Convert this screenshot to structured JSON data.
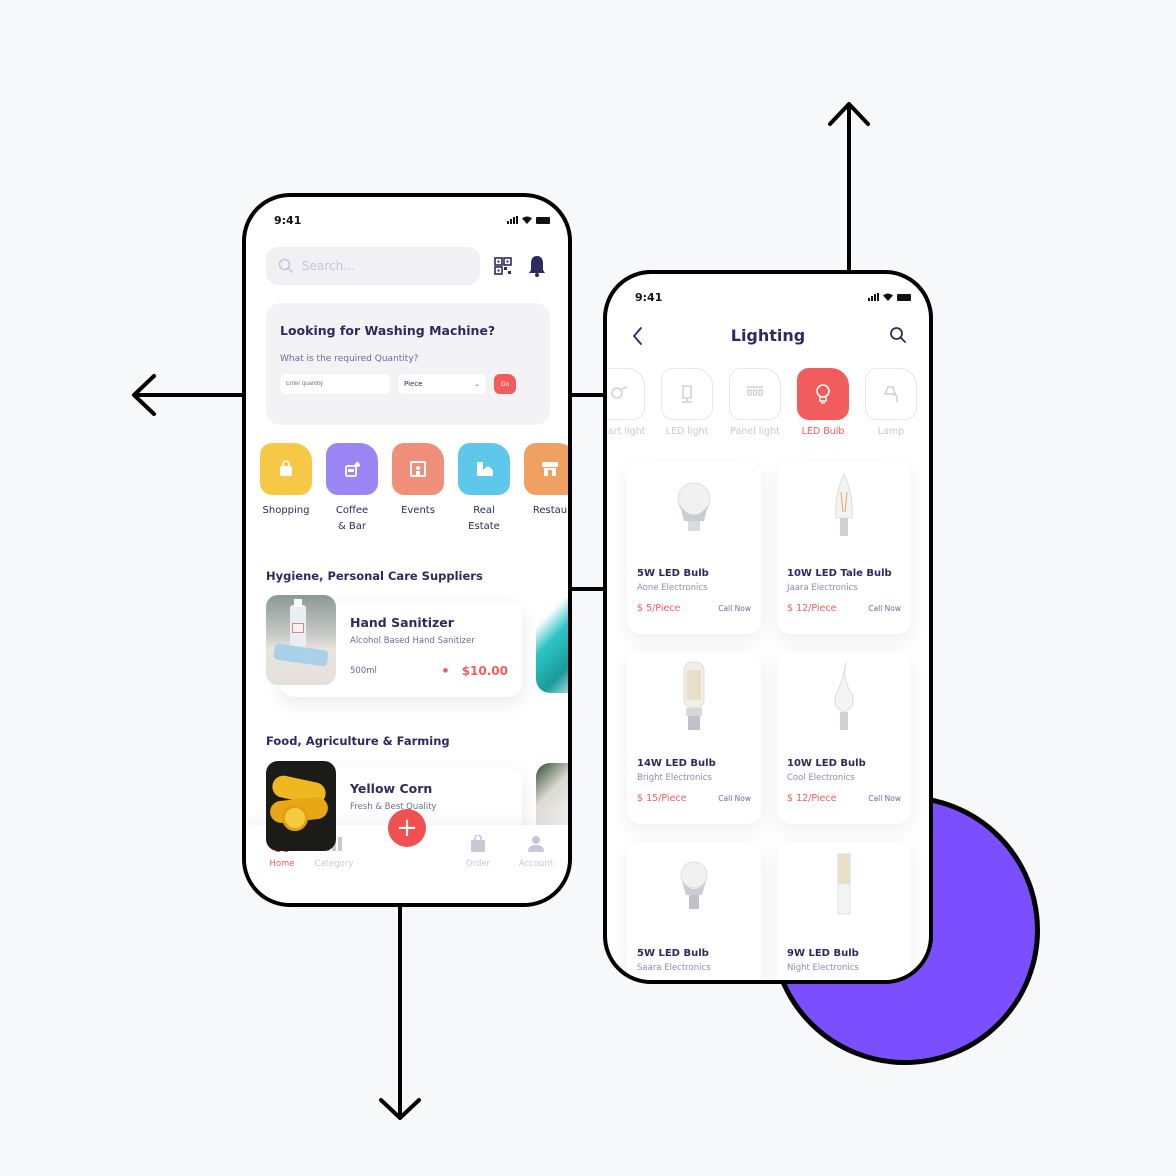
{
  "colors": {
    "accent": "#f25c5c",
    "primary_text": "#2d2a5e",
    "secondary_text": "#6e6a98",
    "muted": "#c8c7d6",
    "circle": "#7b4fff",
    "background": "#f7f8fa"
  },
  "home_screen": {
    "status_time": "9:41",
    "search": {
      "placeholder": "Search...",
      "icon": "search-icon"
    },
    "header_icons": [
      "qr-code-icon",
      "bell-icon"
    ],
    "promo": {
      "title": "Looking for Washing Machine?",
      "subtitle": "What is the required Quantity?",
      "quantity_placeholder": "Enter quantity",
      "unit_selected": "Piece",
      "go_label": "Go"
    },
    "categories": [
      {
        "label": "Shopping",
        "color": "#f5c945",
        "icon": "shopping-bag-icon"
      },
      {
        "label": "Coffee\n& Bar",
        "color": "#9b86f5",
        "icon": "drink-icon"
      },
      {
        "label": "Events",
        "color": "#f0907a",
        "icon": "event-icon"
      },
      {
        "label": "Real\nEstate",
        "color": "#5ec8ea",
        "icon": "real-estate-icon"
      },
      {
        "label": "Restau",
        "color": "#f0a060",
        "icon": "restaurant-icon"
      }
    ],
    "sections": [
      {
        "title": "Hygiene, Personal Care Suppliers",
        "product": {
          "name": "Hand Sanitizer",
          "description": "Alcohol Based Hand Sanitizer",
          "size": "500ml",
          "price": "$10.00"
        }
      },
      {
        "title": "Food, Agriculture & Farming",
        "product": {
          "name": "Yellow Corn",
          "description": "Fresh & Best Quality"
        }
      }
    ],
    "tabbar": {
      "tabs": [
        {
          "label": "Home",
          "icon": "store-icon",
          "active": true
        },
        {
          "label": "Category",
          "icon": "category-icon",
          "active": false
        },
        {
          "label": "Order",
          "icon": "bag-icon",
          "active": false
        },
        {
          "label": "Account",
          "icon": "user-icon",
          "active": false
        }
      ],
      "fab_label": "+"
    }
  },
  "lighting_screen": {
    "status_time": "9:41",
    "title": "Lighting",
    "subcategories": [
      {
        "label": "Smart light",
        "icon": "smart-light-icon",
        "active": false
      },
      {
        "label": "LED light",
        "icon": "led-light-icon",
        "active": false
      },
      {
        "label": "Panel light",
        "icon": "panel-light-icon",
        "active": false
      },
      {
        "label": "LED Bulb",
        "icon": "bulb-icon",
        "active": true
      },
      {
        "label": "Lamp",
        "icon": "lamp-icon",
        "active": false
      }
    ],
    "products": [
      {
        "name": "5W LED Bulb",
        "seller": "Aone Electronics",
        "price": "$ 5/Piece",
        "cta": "Call Now"
      },
      {
        "name": "10W LED Tale Bulb",
        "seller": "Jaara Electronics",
        "price": "$ 12/Piece",
        "cta": "Call Now"
      },
      {
        "name": "14W LED Bulb",
        "seller": "Bright Electronics",
        "price": "$ 15/Piece",
        "cta": "Call Now"
      },
      {
        "name": "10W LED Bulb",
        "seller": "Cool Electronics",
        "price": "$ 12/Piece",
        "cta": "Call Now"
      },
      {
        "name": "5W LED Bulb",
        "seller": "Saara Electronics",
        "price": "",
        "cta": ""
      },
      {
        "name": "9W LED Bulb",
        "seller": "Night Electronics",
        "price": "",
        "cta": ""
      }
    ]
  }
}
